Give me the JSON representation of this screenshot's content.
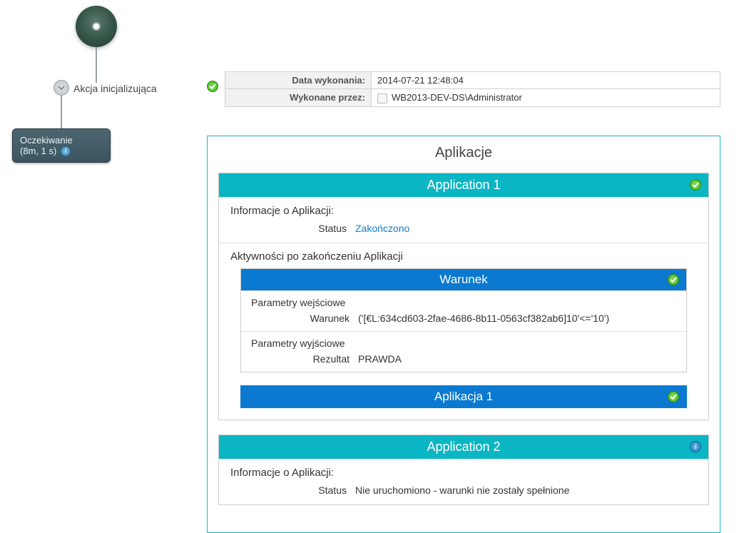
{
  "workflow": {
    "mid_action_label": "Akcja inicjalizująca",
    "state_title": "Oczekiwanie",
    "state_duration": "(8m, 1 s)"
  },
  "meta": {
    "date_label": "Data wykonania:",
    "date_value": "2014-07-21 12:48:04",
    "by_label": "Wykonane przez:",
    "by_value": "WB2013-DEV-DS\\Administrator"
  },
  "apps": {
    "title": "Aplikacje",
    "app1": {
      "title": "Application 1",
      "info_title": "Informacje o Aplikacji:",
      "status_label": "Status",
      "status_value": "Zakończono",
      "activities_title": "Aktywności po zakończeniu Aplikacji",
      "condition": {
        "title": "Warunek",
        "in_title": "Parametry wejściowe",
        "in_label": "Warunek",
        "in_value": "('[€L:634cd603-2fae-4686-8b11-0563cf382ab6]10'<='10')",
        "out_title": "Parametry wyjściowe",
        "out_label": "Rezultat",
        "out_value": "PRAWDA"
      },
      "banner": "Aplikacja 1"
    },
    "app2": {
      "title": "Application 2",
      "info_title": "Informacje o Aplikacji:",
      "status_label": "Status",
      "status_value": "Nie uruchomiono - warunki nie zostały spełnione"
    }
  }
}
